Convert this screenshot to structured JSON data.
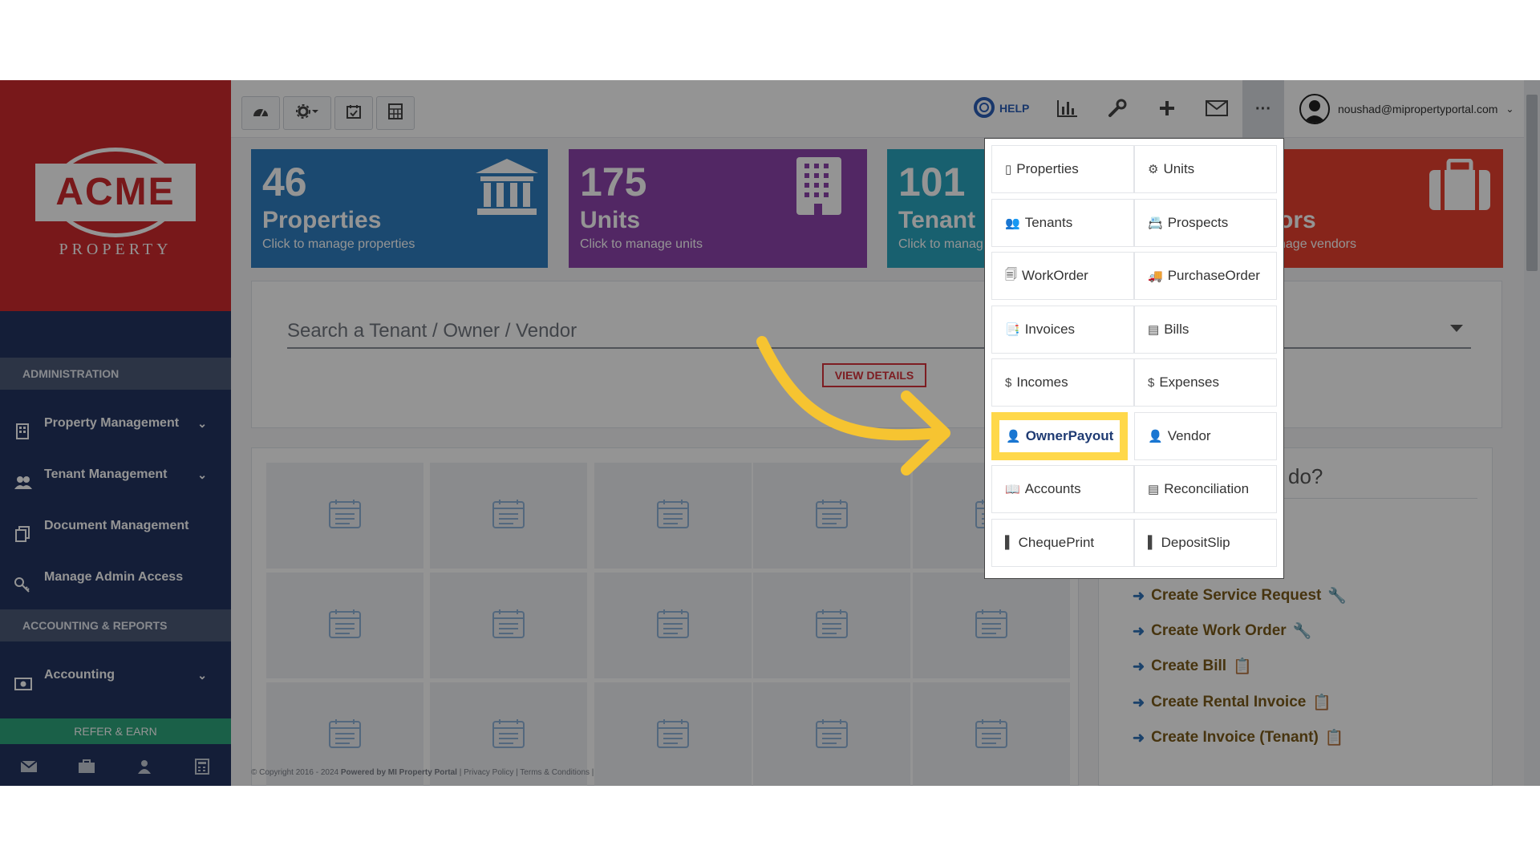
{
  "sidebar": {
    "logo_text": "ACME",
    "logo_sub": "PROPERTY",
    "sections": [
      "ADMINISTRATION",
      "ACCOUNTING & REPORTS"
    ],
    "items": [
      {
        "label": "Property Management",
        "icon": "building-icon"
      },
      {
        "label": "Tenant Management",
        "icon": "users-icon"
      },
      {
        "label": "Document Management",
        "icon": "documents-icon"
      },
      {
        "label": "Manage Admin Access",
        "icon": "key-icon"
      },
      {
        "label": "Accounting",
        "icon": "money-icon"
      }
    ],
    "refer_label": "REFER & EARN",
    "footer_icons": [
      "mail-icon",
      "briefcase-icon",
      "user-icon",
      "calculator-icon"
    ]
  },
  "topbar": {
    "help_label": "HELP",
    "more_label": "···",
    "user_email": "noushad@mipropertyportal.com"
  },
  "cards": [
    {
      "number": "46",
      "label": "Properties",
      "sub": "Click to manage properties",
      "color": "#2f7fc1"
    },
    {
      "number": "175",
      "label": "Units",
      "sub": "Click to manage units",
      "color": "#8e44ad"
    },
    {
      "number": "101",
      "label": "Tenant",
      "sub": "Click to manag",
      "color": "#2aa6c0"
    },
    {
      "number": "",
      "label": "ors",
      "sub": "nage vendors",
      "color": "#e8412f"
    }
  ],
  "search": {
    "placeholder": "Search a Tenant / Owner / Vendor",
    "view_details": "VIEW DETAILS"
  },
  "quick": {
    "title": "do?",
    "links": [
      "Create Service Request",
      "Create Work Order",
      "Create Bill",
      "Create Rental Invoice",
      "Create Invoice (Tenant)"
    ]
  },
  "menu": {
    "items": [
      "Properties",
      "Units",
      "Tenants",
      "Prospects",
      "WorkOrder",
      "PurchaseOrder",
      "Invoices",
      "Bills",
      "Incomes",
      "Expenses",
      "OwnerPayout",
      "Vendor",
      "Accounts",
      "Reconciliation",
      "ChequePrint",
      "DepositSlip"
    ],
    "highlighted": "OwnerPayout"
  },
  "footer": {
    "copyright": "© Copyright 2016 - 2024",
    "powered": "Powered by MI Property Portal",
    "links": "| Privacy Policy | Terms & Conditions |"
  },
  "colors": {
    "sidebar": "#233561",
    "logo_bg": "#cf2a2e",
    "highlight": "#ffd84a",
    "arrow": "#f6c431"
  }
}
